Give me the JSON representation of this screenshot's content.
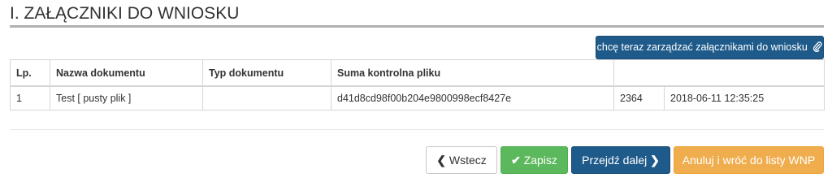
{
  "section": {
    "title": "I. ZAŁĄCZNIKI DO WNIOSKU"
  },
  "manage_button": {
    "label": "chcę teraz zarządzać załącznikami do wniosku",
    "icon": "paperclip-icon"
  },
  "table": {
    "headers": [
      "Lp.",
      "Nazwa dokumentu",
      "Typ dokumentu",
      "Suma kontrolna pliku",
      "",
      ""
    ],
    "rows": [
      [
        "1",
        "Test [ pusty plik ]",
        "",
        "d41d8cd98f00b204e9800998ecf8427e",
        "2364",
        "2018-06-11 12:35:25"
      ]
    ]
  },
  "actions": {
    "back": {
      "label": "Wstecz",
      "icon": "chevron-left-icon"
    },
    "save": {
      "label": "Zapisz",
      "icon": "check-icon"
    },
    "next": {
      "label": "Przejdź dalej",
      "icon": "chevron-right-icon"
    },
    "cancel": {
      "label": "Anuluj i wróć do listy WNP"
    }
  },
  "colors": {
    "primary": "#1e5a8a",
    "success": "#5cb85c",
    "warning": "#f0ad4e"
  }
}
